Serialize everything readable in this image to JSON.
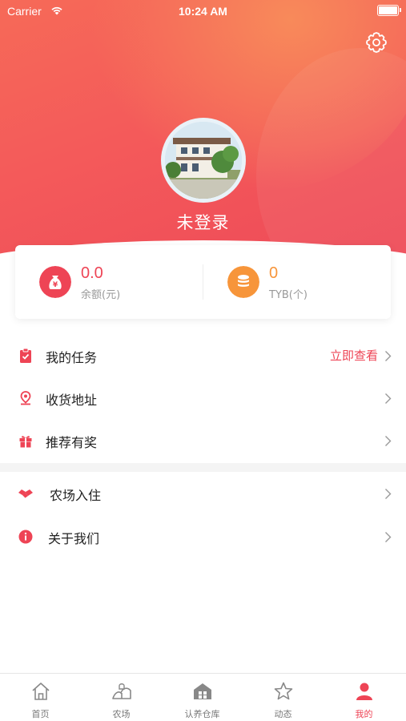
{
  "status_bar": {
    "carrier": "Carrier",
    "time": "10:24 AM"
  },
  "header": {
    "username": "未登录",
    "settings_icon": "gear-icon",
    "avatar_icon": "avatar-photo"
  },
  "balance": {
    "money": {
      "value": "0.0",
      "label": "余额(元)",
      "icon": "money-bag-icon",
      "color": "#ee4455"
    },
    "tyb": {
      "value": "0",
      "label": "TYB(个)",
      "icon": "coin-stack-icon",
      "color": "#f7953a"
    }
  },
  "menu": {
    "items": [
      {
        "label": "我的任务",
        "extra": "立即查看",
        "icon": "task-clipboard-icon"
      },
      {
        "label": "收货地址",
        "extra": "",
        "icon": "location-pin-icon"
      },
      {
        "label": "推荐有奖",
        "extra": "",
        "icon": "gift-icon"
      },
      {
        "label": "农场入住",
        "extra": "",
        "icon": "handshake-icon"
      },
      {
        "label": "关于我们",
        "extra": "",
        "icon": "info-icon"
      }
    ]
  },
  "tabbar": {
    "tabs": [
      {
        "label": "首页",
        "icon": "home-icon"
      },
      {
        "label": "农场",
        "icon": "farm-icon"
      },
      {
        "label": "认养仓库",
        "icon": "warehouse-icon"
      },
      {
        "label": "动态",
        "icon": "star-icon"
      },
      {
        "label": "我的",
        "icon": "person-icon",
        "active": true
      }
    ]
  },
  "colors": {
    "accent": "#ee4455",
    "orange": "#f7953a",
    "header_gradient": [
      "#f66a58",
      "#ee4a58"
    ]
  }
}
